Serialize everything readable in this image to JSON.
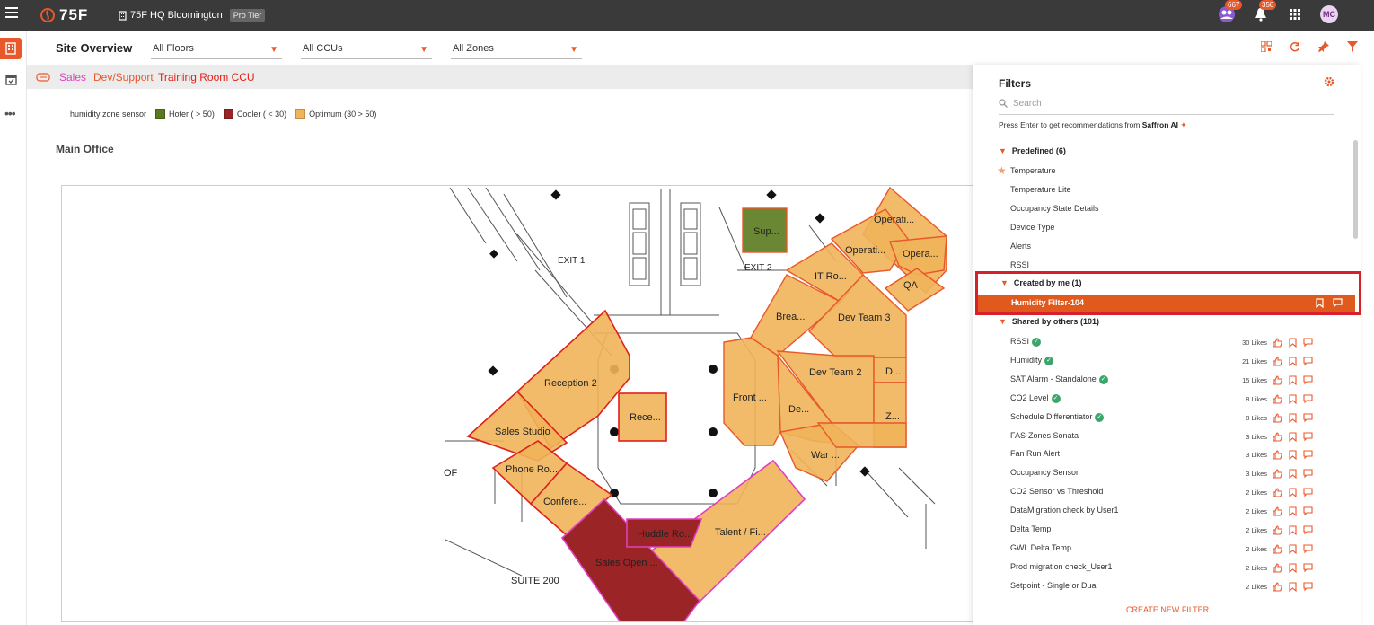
{
  "topbar": {
    "logo_text": "75F",
    "site_name": "75F HQ Bloomington",
    "tier": "Pro Tier",
    "badge_people": "667",
    "badge_bell": "350",
    "avatar_initials": "MC",
    "accent": "#e8582a"
  },
  "toolbar": {
    "title": "Site Overview",
    "floors": "All Floors",
    "ccus": "All CCUs",
    "zones": "All Zones"
  },
  "ccu_bar": {
    "items": [
      "Sales",
      "Dev/Support",
      "Training Room CCU"
    ],
    "colors": [
      "#e040c0",
      "#e8582a",
      "#e0201a"
    ]
  },
  "legend": {
    "label": "humidity zone sensor",
    "entries": [
      {
        "label": "Hoter ( > 50)",
        "color": "#5a7a1e"
      },
      {
        "label": "Cooler ( < 30)",
        "color": "#9a2426"
      },
      {
        "label": "Optimum (30 > 50)",
        "color": "#f0b45a"
      }
    ]
  },
  "map": {
    "floor_title": "Main Office",
    "text_labels": [
      "EXIT 1",
      "EXIT 2",
      "SUITE 200",
      "OF"
    ],
    "zones": {
      "sup": "Sup...",
      "operati1": "Operati...",
      "operati2": "Operati...",
      "opera": "Opera...",
      "qa": "QA",
      "it_ro": "IT Ro...",
      "brea": "Brea...",
      "dev_team3": "Dev Team 3",
      "dev_team2": "Dev Team 2",
      "d": "D...",
      "z": "Z...",
      "de": "De...",
      "war": "War ...",
      "front": "Front ...",
      "reception2": "Reception 2",
      "rece": "Rece...",
      "sales_studio": "Sales Studio",
      "phone_ro": "Phone Ro...",
      "confere": "Confere...",
      "huddle_ro": "Huddle Ro...",
      "talent": "Talent / Fi...",
      "sales_open": "Sales Open ..."
    }
  },
  "filters": {
    "title": "Filters",
    "search_placeholder": "Search",
    "hint_prefix": "Press Enter to get recommendations from ",
    "hint_brand": "Saffron AI",
    "predefined_header": "Predefined (6)",
    "predefined": [
      "Temperature",
      "Temperature Lite",
      "Occupancy State Details",
      "Device Type",
      "Alerts",
      "RSSI"
    ],
    "created_header": "Created by me (1)",
    "created": [
      "Humidity Filter-104"
    ],
    "shared_header": "Shared by others (101)",
    "shared": [
      {
        "name": "RSSI",
        "likes": "30 Likes",
        "verified": true
      },
      {
        "name": "Humidity",
        "likes": "21 Likes",
        "verified": true
      },
      {
        "name": "SAT Alarm - Standalone",
        "likes": "15 Likes",
        "verified": true
      },
      {
        "name": "CO2 Level",
        "likes": "8 Likes",
        "verified": true
      },
      {
        "name": "Schedule Differentiator",
        "likes": "8 Likes",
        "verified": true
      },
      {
        "name": "FAS-Zones Sonata",
        "likes": "3 Likes",
        "verified": false
      },
      {
        "name": "Fan Run Alert",
        "likes": "3 Likes",
        "verified": false
      },
      {
        "name": "Occupancy Sensor",
        "likes": "3 Likes",
        "verified": false
      },
      {
        "name": "CO2 Sensor vs Threshold",
        "likes": "2 Likes",
        "verified": false
      },
      {
        "name": "DataMigration check by User1",
        "likes": "2 Likes",
        "verified": false
      },
      {
        "name": "Delta Temp",
        "likes": "2 Likes",
        "verified": false
      },
      {
        "name": "GWL Delta Temp",
        "likes": "2 Likes",
        "verified": false
      },
      {
        "name": "Prod migration check_User1",
        "likes": "2 Likes",
        "verified": false
      },
      {
        "name": "Setpoint - Single or Dual",
        "likes": "2 Likes",
        "verified": false
      }
    ],
    "create_label": "CREATE NEW FILTER"
  }
}
